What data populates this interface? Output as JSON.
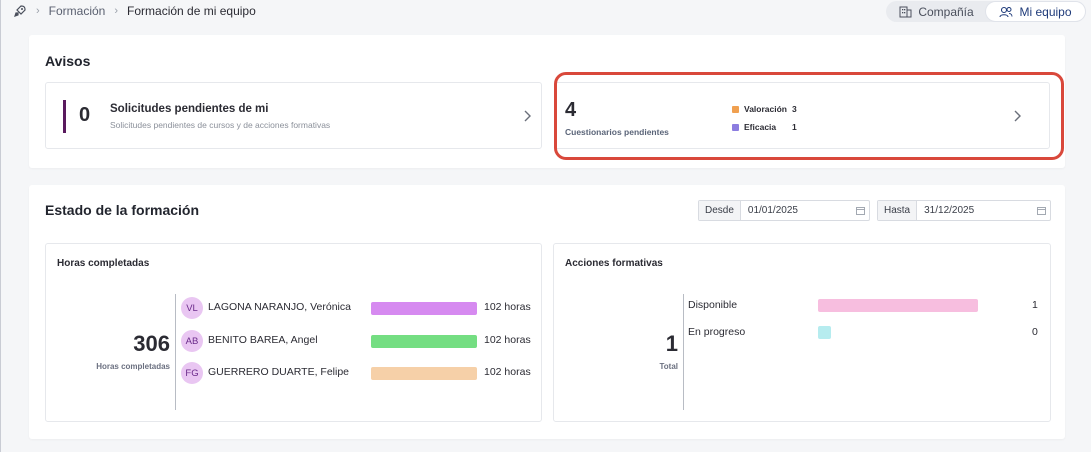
{
  "breadcrumb": {
    "items": [
      "Formación",
      "Formación de mi equipo"
    ]
  },
  "view_toggle": {
    "options": [
      "Compañía",
      "Mi equipo"
    ],
    "active": "Mi equipo"
  },
  "avisos": {
    "title": "Avisos",
    "solicitudes": {
      "count": "0",
      "title": "Solicitudes pendientes de mi",
      "subtitle": "Solicitudes pendientes de cursos y de acciones formativas"
    },
    "cuestionarios": {
      "count": "4",
      "label": "Cuestionarios pendientes",
      "legend": [
        {
          "name": "Valoración",
          "count": "3",
          "color": "#f0a050"
        },
        {
          "name": "Eficacia",
          "count": "1",
          "color": "#8c7de0"
        }
      ]
    }
  },
  "estado": {
    "title": "Estado de la formación",
    "desde": {
      "label": "Desde",
      "value": "01/01/2025"
    },
    "hasta": {
      "label": "Hasta",
      "value": "31/12/2025"
    },
    "horas": {
      "title": "Horas completadas",
      "total": "306",
      "total_label": "Horas completadas",
      "rows": [
        {
          "initials": "VL",
          "name": "LAGONA NARANJO, Verónica",
          "hours": "102 horas",
          "color": "#d68af0",
          "fraction": 1.0
        },
        {
          "initials": "AB",
          "name": "BENITO BAREA, Angel",
          "hours": "102 horas",
          "color": "#74de82",
          "fraction": 1.0
        },
        {
          "initials": "FG",
          "name": "GUERRERO DUARTE, Felipe",
          "hours": "102 horas",
          "color": "#f6d0a8",
          "fraction": 1.0
        }
      ]
    },
    "acciones": {
      "title": "Acciones formativas",
      "total": "1",
      "total_label": "Total",
      "rows": [
        {
          "label": "Disponible",
          "value": "1",
          "color": "#f7bedf",
          "fraction": 1.0
        },
        {
          "label": "En progreso",
          "value": "0",
          "color": "#b6ecef",
          "fraction": 0.0
        }
      ]
    }
  }
}
